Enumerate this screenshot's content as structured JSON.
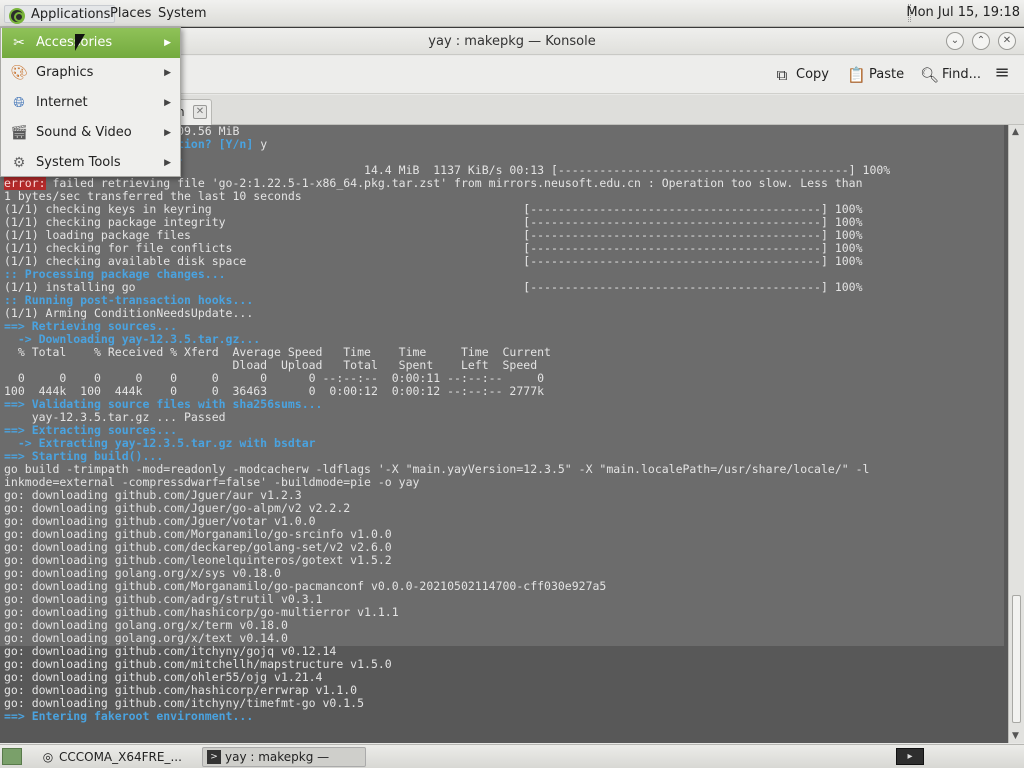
{
  "panel": {
    "applications": "Applications",
    "places": "Places",
    "system": "System",
    "clock": "Mon Jul 15, 19:18"
  },
  "window": {
    "title": "yay : makepkg — Konsole",
    "btn_minimize": "⌄",
    "btn_maximize": "⌃",
    "btn_close": "✕"
  },
  "toolbar": {
    "copy": "Copy",
    "paste": "Paste",
    "find": "Find...",
    "menu_icon": "hamburger-icon"
  },
  "tabs": [
    {
      "label": "n"
    }
  ],
  "menu": {
    "items": [
      {
        "label": "Accessories",
        "icon": "accessories-icon"
      },
      {
        "label": "Graphics",
        "icon": "graphics-icon"
      },
      {
        "label": "Internet",
        "icon": "internet-icon"
      },
      {
        "label": "Sound & Video",
        "icon": "sound-video-icon"
      },
      {
        "label": "System Tools",
        "icon": "system-tools-icon"
      }
    ]
  },
  "terminal": {
    "lines": [
      [
        {
          "t": "                        209.56 MiB"
        }
      ],
      [
        {
          "t": "                       lation? [Y/n] ",
          "c": "c-blue"
        },
        {
          "t": "y"
        }
      ],
      [
        {
          "t": "                       ...",
          "c": "c-blue"
        }
      ],
      [
        {
          "t": " go-2:1.22.5-1-x86_64                               14.4 MiB  1137 KiB/s 00:13 [------------------------------------------] 100%"
        }
      ],
      [
        {
          "t": "error:",
          "c": "c-err"
        },
        {
          "t": " failed retrieving file 'go-2:1.22.5-1-x86_64.pkg.tar.zst' from mirrors.neusoft.edu.cn : Operation too slow. Less than"
        }
      ],
      [
        {
          "t": "1 bytes/sec transferred the last 10 seconds"
        }
      ],
      [
        {
          "t": "(1/1) checking keys in keyring                                             [------------------------------------------] 100%"
        }
      ],
      [
        {
          "t": "(1/1) checking package integrity                                           [------------------------------------------] 100%"
        }
      ],
      [
        {
          "t": "(1/1) loading package files                                                [------------------------------------------] 100%"
        }
      ],
      [
        {
          "t": "(1/1) checking for file conflicts                                          [------------------------------------------] 100%"
        }
      ],
      [
        {
          "t": "(1/1) checking available disk space                                        [------------------------------------------] 100%"
        }
      ],
      [
        {
          "t": ":: Processing package changes...",
          "c": "c-blue"
        }
      ],
      [
        {
          "t": "(1/1) installing go                                                        [------------------------------------------] 100%"
        }
      ],
      [
        {
          "t": ":: Running post-transaction hooks...",
          "c": "c-blue"
        }
      ],
      [
        {
          "t": "(1/1) Arming ConditionNeedsUpdate..."
        }
      ],
      [
        {
          "t": "==> Retrieving sources...",
          "c": "c-blue"
        }
      ],
      [
        {
          "t": "  -> Downloading yay-12.3.5.tar.gz...",
          "c": "c-blue"
        }
      ],
      [
        {
          "t": "  % Total    % Received % Xferd  Average Speed   Time    Time     Time  Current"
        }
      ],
      [
        {
          "t": "                                 Dload  Upload   Total   Spent    Left  Speed"
        }
      ],
      [
        {
          "t": "  0     0    0     0    0     0      0      0 --:--:--  0:00:11 --:--:--     0"
        }
      ],
      [
        {
          "t": "100  444k  100  444k    0     0  36463      0  0:00:12  0:00:12 --:--:-- 2777k"
        }
      ],
      [
        {
          "t": "==> Validating source files with sha256sums...",
          "c": "c-blue"
        }
      ],
      [
        {
          "t": "    yay-12.3.5.tar.gz ... Passed"
        }
      ],
      [
        {
          "t": "==> Extracting sources...",
          "c": "c-blue"
        }
      ],
      [
        {
          "t": "  -> Extracting yay-12.3.5.tar.gz with bsdtar",
          "c": "c-blue"
        }
      ],
      [
        {
          "t": "==> Starting build()...",
          "c": "c-blue"
        }
      ],
      [
        {
          "t": "go build -trimpath -mod=readonly -modcacherw -ldflags '-X \"main.yayVersion=12.3.5\" -X \"main.localePath=/usr/share/locale/\" -l"
        }
      ],
      [
        {
          "t": "inkmode=external -compressdwarf=false' -buildmode=pie -o yay"
        }
      ],
      [
        {
          "t": "go: downloading github.com/Jguer/aur v1.2.3"
        }
      ],
      [
        {
          "t": "go: downloading github.com/Jguer/go-alpm/v2 v2.2.2"
        }
      ],
      [
        {
          "t": "go: downloading github.com/Jguer/votar v1.0.0"
        }
      ],
      [
        {
          "t": "go: downloading github.com/Morganamilo/go-srcinfo v1.0.0"
        }
      ],
      [
        {
          "t": "go: downloading github.com/deckarep/golang-set/v2 v2.6.0"
        }
      ],
      [
        {
          "t": "go: downloading github.com/leonelquinteros/gotext v1.5.2"
        }
      ],
      [
        {
          "t": "go: downloading golang.org/x/sys v0.18.0"
        }
      ],
      [
        {
          "t": "go: downloading github.com/Morganamilo/go-pacmanconf v0.0.0-20210502114700-cff030e927a5"
        }
      ],
      [
        {
          "t": "go: downloading github.com/adrg/strutil v0.3.1"
        }
      ],
      [
        {
          "t": "go: downloading github.com/hashicorp/go-multierror v1.1.1"
        }
      ],
      [
        {
          "t": "go: downloading golang.org/x/term v0.18.0"
        }
      ],
      [
        {
          "t": "go: downloading golang.org/x/text v0.14.0"
        }
      ],
      [
        {
          "t": "go: downloading github.com/itchyny/gojq v0.12.14"
        }
      ],
      [
        {
          "t": "go: downloading github.com/mitchellh/mapstructure v1.5.0"
        }
      ],
      [
        {
          "t": "go: downloading github.com/ohler55/ojg v1.21.4"
        }
      ],
      [
        {
          "t": "go: downloading github.com/hashicorp/errwrap v1.1.0"
        }
      ],
      [
        {
          "t": "go: downloading github.com/itchyny/timefmt-go v0.1.5"
        }
      ],
      [
        {
          "t": "==> Entering fakeroot environment...",
          "c": "c-blue"
        }
      ]
    ]
  },
  "taskbar": {
    "tasks": [
      {
        "label": "CCCOMA_X64FRE_...",
        "icon": "disc-icon"
      },
      {
        "label": "yay : makepkg — Kon...",
        "icon": "terminal-icon"
      }
    ]
  }
}
